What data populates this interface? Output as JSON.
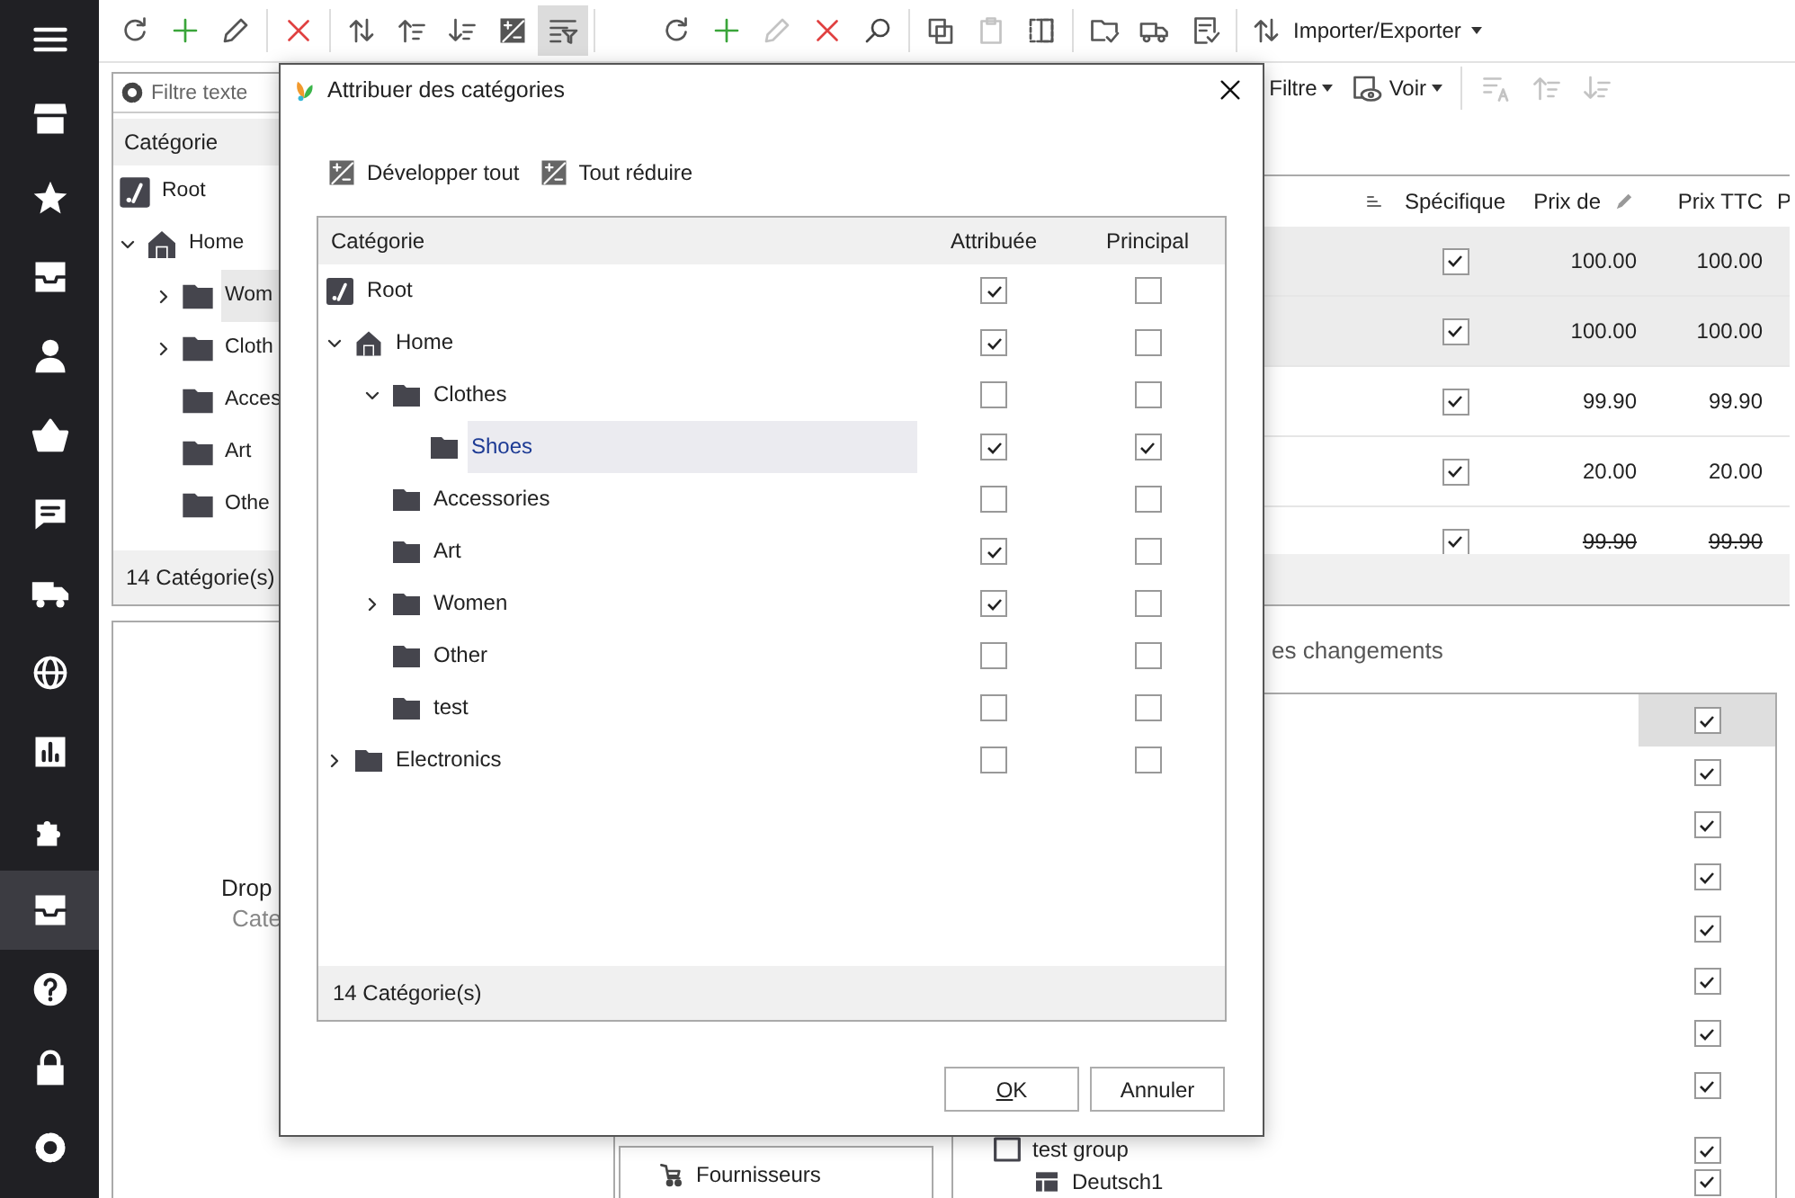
{
  "sidebar": {
    "items": [
      {
        "selected": false
      },
      {
        "selected": false
      },
      {
        "selected": false
      },
      {
        "selected": false
      },
      {
        "selected": false
      },
      {
        "selected": false
      },
      {
        "selected": false
      },
      {
        "selected": false
      },
      {
        "selected": false
      },
      {
        "selected": false
      },
      {
        "selected": false
      },
      {
        "selected": true
      },
      {
        "selected": false
      },
      {
        "selected": false
      },
      {
        "selected": false
      }
    ]
  },
  "toolbar": {
    "buttons": [
      {
        "selected": false,
        "disabled": false
      },
      {
        "selected": false,
        "disabled": false
      },
      {
        "selected": false,
        "disabled": false
      },
      {
        "selected": false,
        "disabled": false
      },
      {
        "selected": false,
        "disabled": false
      },
      {
        "selected": false,
        "disabled": false
      },
      {
        "selected": false,
        "disabled": false
      },
      {
        "selected": false,
        "disabled": false
      },
      {
        "selected": true,
        "disabled": false
      },
      {
        "selected": false,
        "disabled": false
      },
      {
        "selected": false,
        "disabled": false
      },
      {
        "selected": false,
        "disabled": true
      },
      {
        "selected": false,
        "disabled": false
      },
      {
        "selected": false,
        "disabled": false
      },
      {
        "selected": false,
        "disabled": false
      },
      {
        "selected": false,
        "disabled": true
      },
      {
        "selected": false,
        "disabled": false
      },
      {
        "selected": false,
        "disabled": false
      },
      {
        "selected": false,
        "disabled": false
      },
      {
        "selected": false,
        "disabled": false
      },
      {
        "label": "Importer/Exporter",
        "selected": false,
        "disabled": false
      }
    ]
  },
  "left_panel": {
    "filter": {
      "placeholder": "Filtre texte"
    },
    "column": "Catégorie",
    "tree": [
      {
        "label": "Root",
        "kind": "root",
        "selected": false,
        "children": [
          {
            "label": "Home",
            "kind": "home",
            "selected": false,
            "expanded": true,
            "children": [
              {
                "label": "Wom",
                "kind": "folder",
                "selected": true,
                "expanded": false
              },
              {
                "label": "Cloth",
                "kind": "folder",
                "selected": false,
                "expanded": false
              },
              {
                "label": "Acces",
                "kind": "folder",
                "selected": false
              },
              {
                "label": "Art",
                "kind": "folder",
                "selected": false
              },
              {
                "label": "Othe",
                "kind": "folder",
                "selected": false
              }
            ]
          }
        ]
      }
    ],
    "status": "14 Catégorie(s)"
  },
  "secondary_toolbar": {
    "buttons": [
      {
        "label": "Filtre",
        "kind": "menu",
        "disabled": false
      },
      {
        "label": "Voir",
        "kind": "view",
        "disabled": false
      },
      {
        "kind": "sort-az",
        "disabled": true
      },
      {
        "kind": "sort-up",
        "disabled": true
      },
      {
        "kind": "sort-down",
        "disabled": true
      }
    ]
  },
  "products_table": {
    "columns": [
      {
        "kind": "sort"
      },
      {
        "label": "Spécifique",
        "kind": "text"
      },
      {
        "label": "Prix de",
        "kind": "editable"
      },
      {
        "label": "Prix TTC",
        "kind": "text"
      },
      {
        "label": "P",
        "kind": "text"
      }
    ],
    "rows": [
      {
        "specific": true,
        "price": "100.00",
        "price_ttc": "100.00",
        "selected": true,
        "strikethrough": false
      },
      {
        "specific": true,
        "price": "100.00",
        "price_ttc": "100.00",
        "selected": true,
        "strikethrough": false
      },
      {
        "specific": true,
        "price": "99.90",
        "price_ttc": "99.90",
        "selected": false,
        "strikethrough": false
      },
      {
        "specific": true,
        "price": "20.00",
        "price_ttc": "20.00",
        "selected": false,
        "strikethrough": false
      },
      {
        "specific": true,
        "price": "99.90",
        "price_ttc": "99.90",
        "selected": false,
        "strikethrough": true
      }
    ]
  },
  "drop_area": {
    "title": "Drop",
    "hint": "Cate"
  },
  "suppliers_button": "Fournisseurs",
  "changes_text": "es changements",
  "lower_tree": {
    "rows": [
      {
        "checked": true,
        "selected": true
      },
      {
        "checked": true,
        "selected": false
      },
      {
        "checked": true,
        "selected": false
      },
      {
        "checked": true,
        "selected": false
      },
      {
        "checked": true,
        "selected": false
      },
      {
        "checked": true,
        "selected": false
      },
      {
        "checked": true,
        "selected": false
      },
      {
        "checked": true,
        "selected": false
      },
      {
        "label": "test group",
        "kind": "group",
        "checked": true,
        "selected": false,
        "children": [
          {
            "label": "Deutsch1",
            "kind": "language",
            "checked": true,
            "selected": false
          }
        ]
      }
    ]
  },
  "dialog": {
    "title": "Attribuer des catégories",
    "expand_all": "Développer tout",
    "collapse_all": "Tout réduire",
    "columns": [
      "Catégorie",
      "Attribuée",
      "Principal"
    ],
    "tree": [
      {
        "label": "Root",
        "kind": "root",
        "assigned": true,
        "main": false,
        "selected": false,
        "children": [
          {
            "label": "Home",
            "kind": "home",
            "assigned": true,
            "main": false,
            "selected": false,
            "expanded": true,
            "children": [
              {
                "label": "Clothes",
                "kind": "folder",
                "assigned": false,
                "main": false,
                "selected": false,
                "expanded": true,
                "children": [
                  {
                    "label": "Shoes",
                    "kind": "folder",
                    "assigned": true,
                    "main": true,
                    "selected": true
                  }
                ]
              },
              {
                "label": "Accessories",
                "kind": "folder",
                "assigned": false,
                "main": false,
                "selected": false
              },
              {
                "label": "Art",
                "kind": "folder",
                "assigned": true,
                "main": false,
                "selected": false
              },
              {
                "label": "Women",
                "kind": "folder",
                "assigned": true,
                "main": false,
                "selected": false,
                "expanded": false
              },
              {
                "label": "Other",
                "kind": "folder",
                "assigned": false,
                "main": false,
                "selected": false
              },
              {
                "label": "test",
                "kind": "folder",
                "assigned": false,
                "main": false,
                "selected": false
              }
            ]
          },
          {
            "label": "Electronics",
            "kind": "folder",
            "assigned": false,
            "main": false,
            "selected": false,
            "expanded": false
          }
        ]
      }
    ],
    "status": "14 Catégorie(s)",
    "buttons": [
      {
        "label": "OK",
        "kind": "primary"
      },
      {
        "label": "Annuler",
        "kind": "secondary"
      }
    ]
  }
}
